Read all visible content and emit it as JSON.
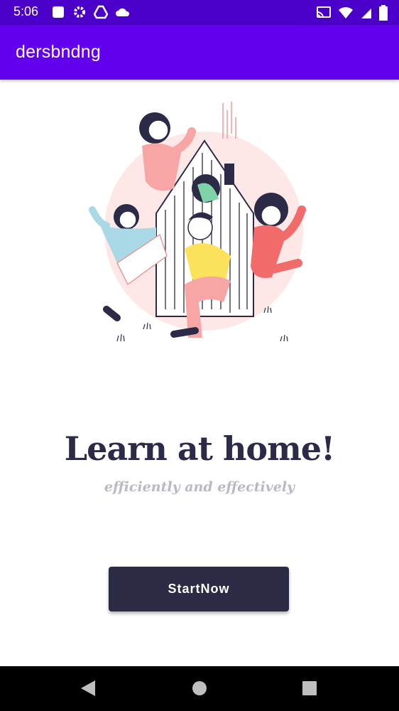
{
  "status_bar": {
    "time": "5:06",
    "left_icons": [
      "square-notification-icon",
      "gear-icon",
      "drive-icon",
      "cloud-icon"
    ],
    "right_icons": [
      "cast-icon",
      "wifi-icon",
      "signal-icon",
      "battery-icon"
    ]
  },
  "app_bar": {
    "title": "dersbndng"
  },
  "main": {
    "headline": "Learn at home!",
    "subline": "efficiently and effectively",
    "start_button": "StartNow"
  },
  "nav_bar": {
    "buttons": [
      "back-icon",
      "home-icon",
      "recents-icon"
    ]
  },
  "colors": {
    "status_bar": "#4a00c8",
    "app_bar": "#6200ee",
    "button": "#2c2b46",
    "headline": "#2b2a47",
    "subline": "#b9b8c4"
  }
}
